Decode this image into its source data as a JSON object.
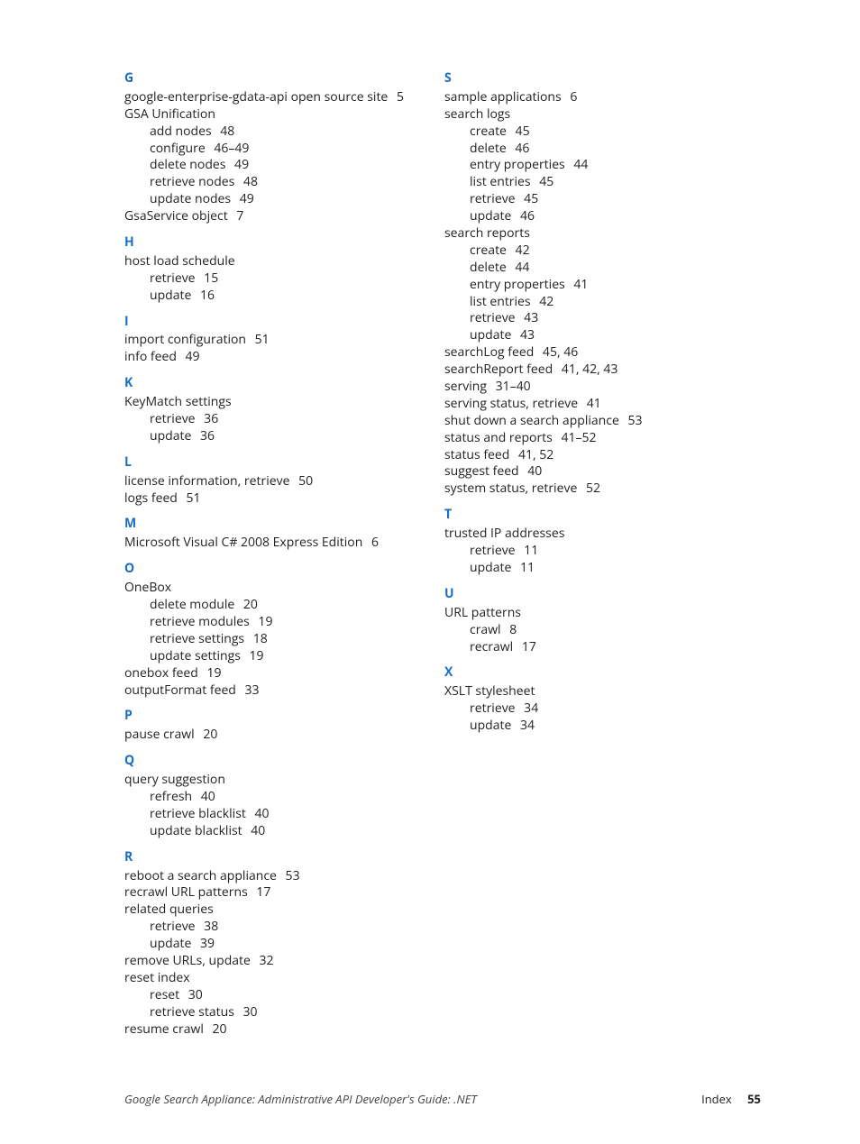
{
  "columns": [
    [
      {
        "type": "letter",
        "text": "G"
      },
      {
        "type": "entry",
        "text": "google-enterprise-gdata-api open source site",
        "page": "5"
      },
      {
        "type": "entry",
        "text": "GSA Unification"
      },
      {
        "type": "sub",
        "text": "add nodes",
        "page": "48"
      },
      {
        "type": "sub",
        "text": "configure",
        "page": "46–49"
      },
      {
        "type": "sub",
        "text": "delete nodes",
        "page": "49"
      },
      {
        "type": "sub",
        "text": "retrieve nodes",
        "page": "48"
      },
      {
        "type": "sub",
        "text": "update nodes",
        "page": "49"
      },
      {
        "type": "entry",
        "text": "GsaService object",
        "page": "7"
      },
      {
        "type": "letter",
        "text": "H"
      },
      {
        "type": "entry",
        "text": "host load schedule"
      },
      {
        "type": "sub",
        "text": "retrieve",
        "page": "15"
      },
      {
        "type": "sub",
        "text": "update",
        "page": "16"
      },
      {
        "type": "letter",
        "text": "I"
      },
      {
        "type": "entry",
        "text": "import configuration",
        "page": "51"
      },
      {
        "type": "entry",
        "text": "info feed",
        "page": "49"
      },
      {
        "type": "letter",
        "text": "K"
      },
      {
        "type": "entry",
        "text": "KeyMatch settings"
      },
      {
        "type": "sub",
        "text": "retrieve",
        "page": "36"
      },
      {
        "type": "sub",
        "text": "update",
        "page": "36"
      },
      {
        "type": "letter",
        "text": "L"
      },
      {
        "type": "entry",
        "text": "license information, retrieve",
        "page": "50"
      },
      {
        "type": "entry",
        "text": "logs feed",
        "page": "51"
      },
      {
        "type": "letter",
        "text": "M"
      },
      {
        "type": "entry",
        "text": "Microsoft Visual C# 2008 Express Edition",
        "page": "6"
      },
      {
        "type": "letter",
        "text": "O"
      },
      {
        "type": "entry",
        "text": "OneBox"
      },
      {
        "type": "sub",
        "text": "delete module",
        "page": "20"
      },
      {
        "type": "sub",
        "text": "retrieve modules",
        "page": "19"
      },
      {
        "type": "sub",
        "text": "retrieve settings",
        "page": "18"
      },
      {
        "type": "sub",
        "text": "update settings",
        "page": "19"
      },
      {
        "type": "entry",
        "text": "onebox feed",
        "page": "19"
      },
      {
        "type": "entry",
        "text": "outputFormat feed",
        "page": "33"
      },
      {
        "type": "letter",
        "text": "P"
      },
      {
        "type": "entry",
        "text": "pause crawl",
        "page": "20"
      },
      {
        "type": "letter",
        "text": "Q"
      },
      {
        "type": "entry",
        "text": "query suggestion"
      },
      {
        "type": "sub",
        "text": "refresh",
        "page": "40"
      },
      {
        "type": "sub",
        "text": "retrieve blacklist",
        "page": "40"
      },
      {
        "type": "sub",
        "text": "update blacklist",
        "page": "40"
      },
      {
        "type": "letter",
        "text": "R"
      },
      {
        "type": "entry",
        "text": "reboot a search appliance",
        "page": "53"
      },
      {
        "type": "entry",
        "text": "recrawl URL patterns",
        "page": "17"
      },
      {
        "type": "entry",
        "text": "related queries"
      },
      {
        "type": "sub",
        "text": "retrieve",
        "page": "38"
      },
      {
        "type": "sub",
        "text": "update",
        "page": "39"
      },
      {
        "type": "entry",
        "text": "remove URLs, update",
        "page": "32"
      },
      {
        "type": "entry",
        "text": "reset index"
      },
      {
        "type": "sub",
        "text": "reset",
        "page": "30"
      },
      {
        "type": "sub",
        "text": "retrieve status",
        "page": "30"
      },
      {
        "type": "entry",
        "text": "resume crawl",
        "page": "20"
      }
    ],
    [
      {
        "type": "letter",
        "text": "S"
      },
      {
        "type": "entry",
        "text": "sample applications",
        "page": "6"
      },
      {
        "type": "entry",
        "text": "search logs"
      },
      {
        "type": "sub",
        "text": "create",
        "page": "45"
      },
      {
        "type": "sub",
        "text": "delete",
        "page": "46"
      },
      {
        "type": "sub",
        "text": "entry properties",
        "page": "44"
      },
      {
        "type": "sub",
        "text": "list entries",
        "page": "45"
      },
      {
        "type": "sub",
        "text": "retrieve",
        "page": "45"
      },
      {
        "type": "sub",
        "text": "update",
        "page": "46"
      },
      {
        "type": "entry",
        "text": "search reports"
      },
      {
        "type": "sub",
        "text": "create",
        "page": "42"
      },
      {
        "type": "sub",
        "text": "delete",
        "page": "44"
      },
      {
        "type": "sub",
        "text": "entry properties",
        "page": "41"
      },
      {
        "type": "sub",
        "text": "list entries",
        "page": "42"
      },
      {
        "type": "sub",
        "text": "retrieve",
        "page": "43"
      },
      {
        "type": "sub",
        "text": "update",
        "page": "43"
      },
      {
        "type": "entry",
        "text": "searchLog feed",
        "page": "45, 46"
      },
      {
        "type": "entry",
        "text": "searchReport feed",
        "page": "41, 42, 43"
      },
      {
        "type": "entry",
        "text": "serving",
        "page": "31–40"
      },
      {
        "type": "entry",
        "text": "serving status, retrieve",
        "page": "41"
      },
      {
        "type": "entry",
        "text": "shut down a search appliance",
        "page": "53"
      },
      {
        "type": "entry",
        "text": "status and reports",
        "page": "41–52"
      },
      {
        "type": "entry",
        "text": "status feed",
        "page": "41, 52"
      },
      {
        "type": "entry",
        "text": "suggest feed",
        "page": "40"
      },
      {
        "type": "entry",
        "text": "system status, retrieve",
        "page": "52"
      },
      {
        "type": "letter",
        "text": "T"
      },
      {
        "type": "entry",
        "text": "trusted IP addresses"
      },
      {
        "type": "sub",
        "text": "retrieve",
        "page": "11"
      },
      {
        "type": "sub",
        "text": "update",
        "page": "11"
      },
      {
        "type": "letter",
        "text": "U"
      },
      {
        "type": "entry",
        "text": "URL patterns"
      },
      {
        "type": "sub",
        "text": "crawl",
        "page": "8"
      },
      {
        "type": "sub",
        "text": "recrawl",
        "page": "17"
      },
      {
        "type": "letter",
        "text": "X"
      },
      {
        "type": "entry",
        "text": "XSLT stylesheet"
      },
      {
        "type": "sub",
        "text": "retrieve",
        "page": "34"
      },
      {
        "type": "sub",
        "text": "update",
        "page": "34"
      }
    ]
  ],
  "footer": {
    "left": "Google Search Appliance: Administrative API Developer's Guide: .NET",
    "right_label": "Index",
    "right_page": "55"
  }
}
